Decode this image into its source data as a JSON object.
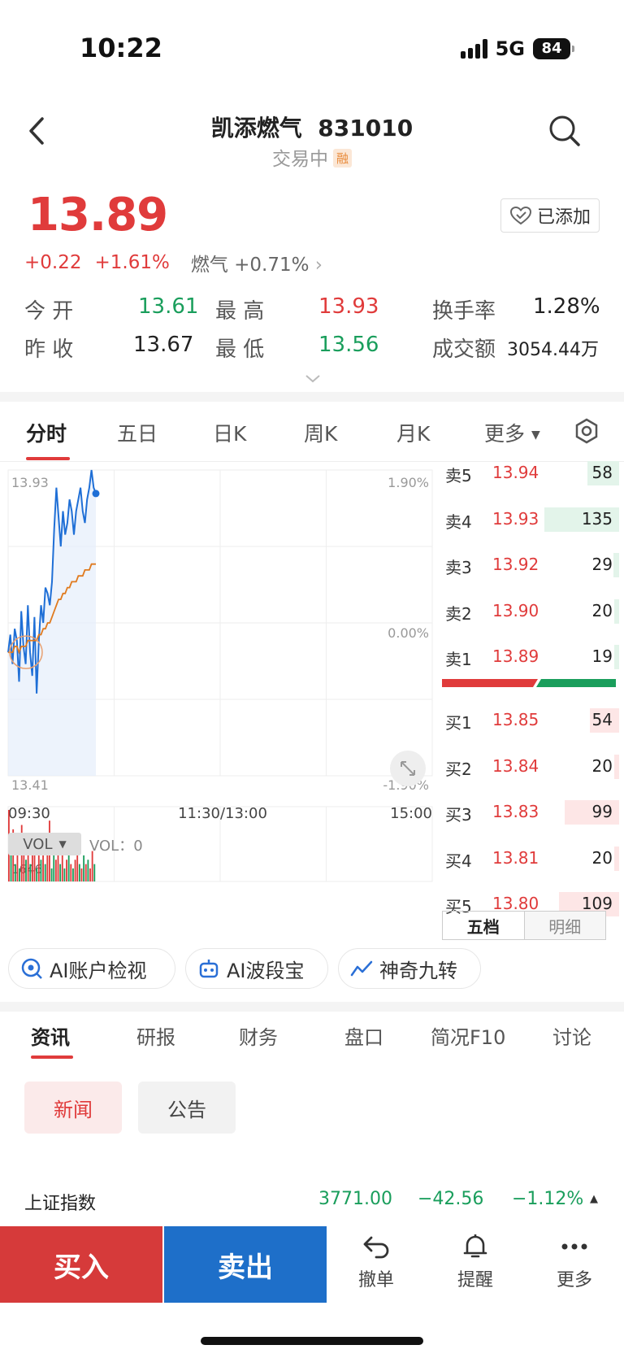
{
  "status_bar": {
    "time": "10:22",
    "network": "5G",
    "battery": "84"
  },
  "header": {
    "stock_name": "凯添燃气",
    "stock_code": "831010",
    "title": "凯添燃气  831010",
    "status": "交易中",
    "margin_tag": "融"
  },
  "quote": {
    "price": "13.89",
    "change": "+0.22",
    "change_pct": "+1.61%",
    "sector": "燃气 +0.71%",
    "watch_label": "已添加",
    "stats": [
      {
        "label": "今 开",
        "value": "13.61",
        "color": "green"
      },
      {
        "label": "最 高",
        "value": "13.93",
        "color": "red"
      },
      {
        "label": "换手率",
        "value": "1.28%",
        "color": "black"
      },
      {
        "label": "昨 收",
        "value": "13.67",
        "color": "black"
      },
      {
        "label": "最 低",
        "value": "13.56",
        "color": "green"
      },
      {
        "label": "成交额",
        "value": "3054.44万",
        "color": "black"
      }
    ]
  },
  "chart_tabs": [
    "分时",
    "五日",
    "日K",
    "周K",
    "月K",
    "更多"
  ],
  "chart_data": {
    "type": "line",
    "title": "",
    "x_axis_labels": [
      "09:30",
      "11:30/13:00",
      "15:00"
    ],
    "y_axis": {
      "max": "13.93",
      "min": "13.41",
      "ylim": [
        13.41,
        13.93
      ]
    },
    "right_axis": {
      "top": "1.90%",
      "mid": "0.00%",
      "bottom": "-1.90%"
    },
    "series": [
      {
        "name": "",
        "color": "#1f6fd6",
        "values": [
          13.62,
          13.65,
          13.6,
          13.66,
          13.64,
          13.57,
          13.69,
          13.63,
          13.6,
          13.7,
          13.62,
          13.58,
          13.68,
          13.55,
          13.64,
          13.7,
          13.67,
          13.73,
          13.72,
          13.7,
          13.74,
          13.83,
          13.9,
          13.85,
          13.8,
          13.86,
          13.82,
          13.84,
          13.88,
          13.86,
          13.82,
          13.86,
          13.88,
          13.9,
          13.86,
          13.84,
          13.88,
          13.9,
          13.93,
          13.9,
          13.89
        ]
      },
      {
        "name": "",
        "color": "#e07a1e",
        "values": [
          13.62,
          13.62,
          13.62,
          13.63,
          13.63,
          13.62,
          13.63,
          13.63,
          13.63,
          13.64,
          13.64,
          13.64,
          13.64,
          13.64,
          13.65,
          13.65,
          13.66,
          13.66,
          13.67,
          13.67,
          13.68,
          13.69,
          13.7,
          13.71,
          13.71,
          13.72,
          13.72,
          13.73,
          13.73,
          13.74,
          13.74,
          13.74,
          13.75,
          13.75,
          13.75,
          13.76,
          13.76,
          13.76,
          13.77,
          13.77,
          13.77
        ]
      }
    ],
    "volume": {
      "label": "VOL",
      "readout": "VOL：0",
      "max_label": "1646",
      "bars": [
        1646,
        600,
        1200,
        400,
        900,
        300,
        1300,
        700,
        500,
        1000,
        400,
        600,
        1100,
        300,
        800,
        500,
        700,
        400,
        900,
        1400,
        300,
        600,
        500,
        800,
        400,
        700,
        300,
        500,
        600,
        400,
        300,
        500,
        700,
        400,
        300,
        600,
        400,
        500,
        300,
        700,
        400
      ],
      "colors": [
        "r",
        "g",
        "r",
        "g",
        "r",
        "g",
        "r",
        "r",
        "g",
        "r",
        "g",
        "r",
        "r",
        "g",
        "r",
        "g",
        "r",
        "g",
        "r",
        "r",
        "g",
        "g",
        "r",
        "r",
        "g",
        "r",
        "g",
        "r",
        "g",
        "r",
        "g",
        "r",
        "r",
        "g",
        "r",
        "g",
        "r",
        "g",
        "r",
        "r",
        "g"
      ]
    }
  },
  "order_book": {
    "asks": [
      {
        "label": "卖5",
        "price": "13.94",
        "qty": "58",
        "bar": 0.28
      },
      {
        "label": "卖4",
        "price": "13.93",
        "qty": "135",
        "bar": 0.66
      },
      {
        "label": "卖3",
        "price": "13.92",
        "qty": "29",
        "bar": 0.05
      },
      {
        "label": "卖2",
        "price": "13.90",
        "qty": "20",
        "bar": 0.04
      },
      {
        "label": "卖1",
        "price": "13.89",
        "qty": "19",
        "bar": 0.04
      }
    ],
    "bids": [
      {
        "label": "买1",
        "price": "13.85",
        "qty": "54",
        "bar": 0.26
      },
      {
        "label": "买2",
        "price": "13.84",
        "qty": "20",
        "bar": 0.04
      },
      {
        "label": "买3",
        "price": "13.83",
        "qty": "99",
        "bar": 0.48
      },
      {
        "label": "买4",
        "price": "13.81",
        "qty": "20",
        "bar": 0.04
      },
      {
        "label": "买5",
        "price": "13.80",
        "qty": "109",
        "bar": 0.53
      }
    ],
    "tabs": [
      "五档",
      "明细"
    ]
  },
  "ai_tools": [
    "AI账户检视",
    "AI波段宝",
    "神奇九转"
  ],
  "info_tabs": [
    "资讯",
    "研报",
    "财务",
    "盘口",
    "简况F10",
    "讨论"
  ],
  "news_chips": [
    "新闻",
    "公告"
  ],
  "ticker": {
    "name": "上证指数",
    "value": "3771.00",
    "change": "−42.56",
    "change_pct": "−1.12%"
  },
  "bottom_bar": {
    "buy": "买入",
    "sell": "卖出",
    "revoke": "撤单",
    "alert": "提醒",
    "more": "更多"
  },
  "colors": {
    "up": "#e03b3b",
    "down": "#1a9e5c",
    "buy": "#d63a3a",
    "sell": "#1e6fc9"
  }
}
